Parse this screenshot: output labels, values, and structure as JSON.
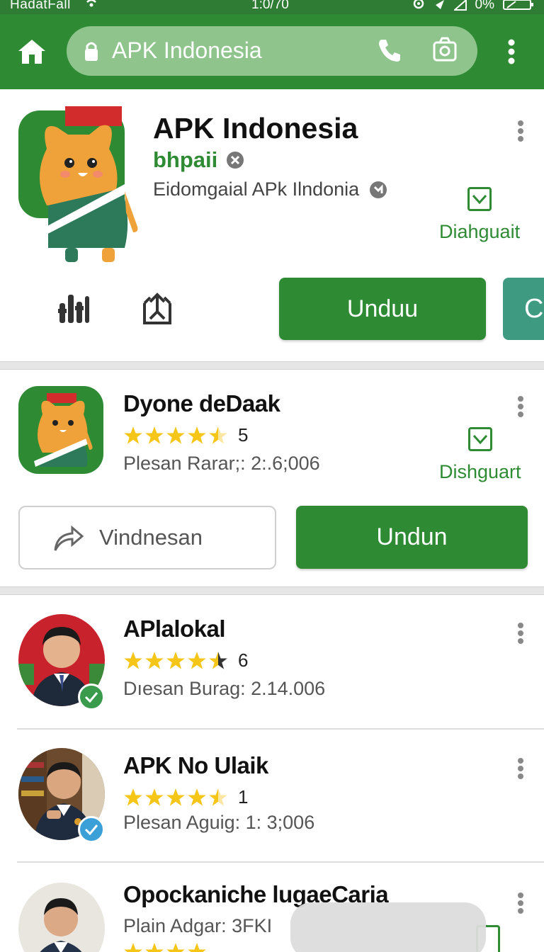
{
  "status_bar": {
    "carrier": "HadatFall",
    "time": "1:0/70",
    "battery": "0%"
  },
  "browser": {
    "url_text": "APK Indonesia"
  },
  "hero": {
    "title": "APK Indonesia",
    "developer": "bhpaii",
    "description": "Eidomgaial APk Ilndonia",
    "saved_label": "Diahguait",
    "download_label": "Unduu",
    "secondary_label": "C"
  },
  "items": [
    {
      "name": "Dyone deDaak",
      "stars": 4.5,
      "rating_text": "5",
      "meta": "Plesan Rarar;: 2:.6;006",
      "saved_label": "Dishguart",
      "share_label": "Vindnesan",
      "download_label": "Undun"
    },
    {
      "name": "APlalokal",
      "stars": 4.5,
      "rating_text": "6",
      "meta": "Dıesan Burag: 2.14.006"
    },
    {
      "name": "APK No Ulaik",
      "stars": 4.5,
      "rating_text": "1",
      "meta": "Plesan Aguig: 1: 3;006"
    },
    {
      "name": "Opockaniche lugaeCaria",
      "meta": "Plain Adgar: 3FKI"
    }
  ],
  "colors": {
    "primary_green": "#2e8b34",
    "teal": "#3f9a82",
    "star": "#f5c518"
  },
  "icons": [
    "home-icon",
    "lock-icon",
    "phone-icon",
    "camera-icon",
    "more-vert-icon",
    "checkbox-icon",
    "equalizer-icon",
    "share-box-icon",
    "share-arrow-icon",
    "verified-icon",
    "star-icon"
  ]
}
